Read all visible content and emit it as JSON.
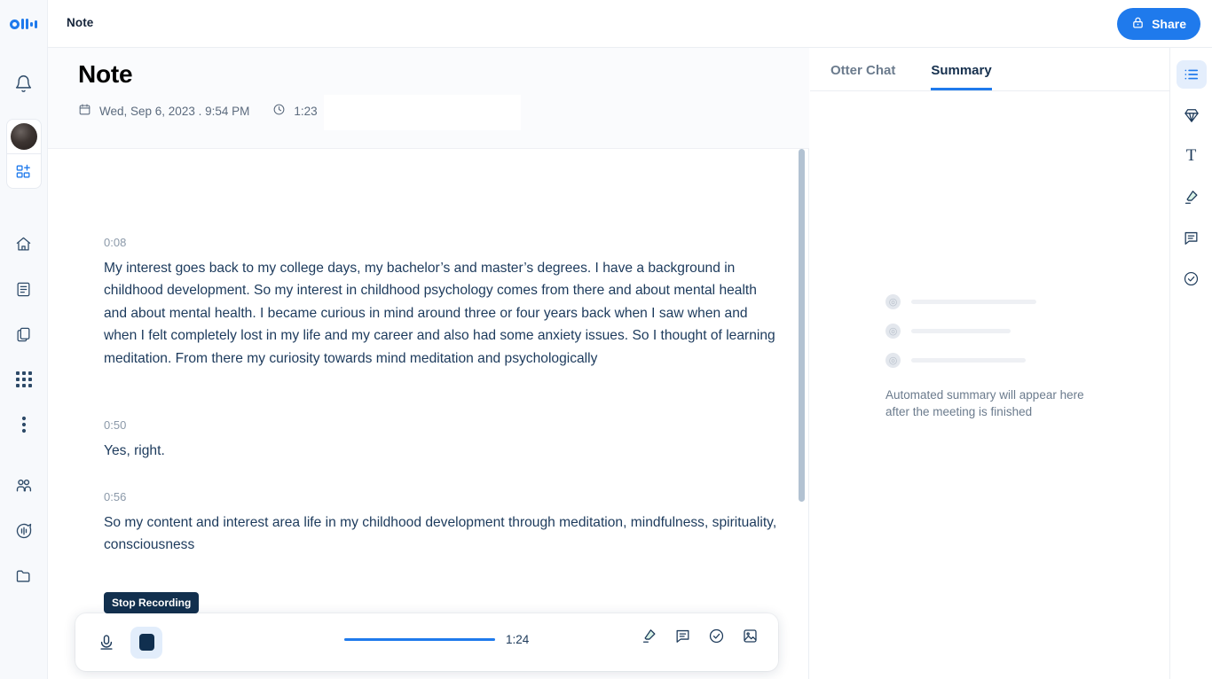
{
  "app": {
    "logo_name": "otter-ai-logo",
    "accent_color": "#1f7aec",
    "text_color": "#1c3a5c"
  },
  "topbar": {
    "title": "Note",
    "share_label": "Share",
    "share_icon": "lock-icon"
  },
  "left_rail": {
    "items": [
      {
        "name": "notifications",
        "icon": "bell-icon"
      },
      {
        "name": "account-avatar",
        "icon": "avatar"
      },
      {
        "name": "new-note",
        "icon": "new-note-icon"
      },
      {
        "name": "home",
        "icon": "home-icon"
      },
      {
        "name": "my-notes",
        "icon": "document-icon"
      },
      {
        "name": "shared-with-me",
        "icon": "copy-icon"
      },
      {
        "name": "all-apps",
        "icon": "grid-icon"
      },
      {
        "name": "more",
        "icon": "more-vertical-icon"
      },
      {
        "name": "people",
        "icon": "people-icon"
      },
      {
        "name": "channels",
        "icon": "speech-wave-icon"
      },
      {
        "name": "folders",
        "icon": "folder-icon"
      }
    ]
  },
  "note": {
    "title": "Note",
    "date": "Wed, Sep 6, 2023 . 9:54 PM",
    "duration": "1:23",
    "calendar_icon": "calendar-icon",
    "clock_icon": "clock-icon"
  },
  "transcript": {
    "segments": [
      {
        "time": "0:08",
        "text": "My interest goes back to my college days, my bachelor’s and master’s degrees. I have a background in childhood development. So my interest in childhood psychology comes from there and about mental health and about mental health. I became curious in mind around three or four years back when I saw when and when I felt completely lost in my life and my career and also had some anxiety issues. So I thought of learning meditation. From there my curiosity towards mind meditation and psychologically"
      },
      {
        "time": "0:50",
        "text": "Yes, right."
      },
      {
        "time": "0:56",
        "text": "So my content and interest area life in my childhood development through meditation, mindfulness, spirituality, consciousness"
      }
    ]
  },
  "recording_bar": {
    "tooltip": "Stop Recording",
    "mic_icon": "microphone-icon",
    "stop_icon": "stop-square-icon",
    "elapsed": "1:24",
    "progress_percent": 100,
    "tools": [
      {
        "name": "highlight",
        "icon": "highlighter-icon"
      },
      {
        "name": "comment",
        "icon": "comment-icon"
      },
      {
        "name": "action-item",
        "icon": "check-circle-icon"
      },
      {
        "name": "add-image",
        "icon": "image-icon"
      }
    ]
  },
  "right_panel": {
    "tabs": [
      {
        "label": "Otter Chat",
        "active": false
      },
      {
        "label": "Summary",
        "active": true
      }
    ],
    "empty_state": {
      "text": "Automated summary will appear here after the meeting is finished",
      "skeleton_rows": 3
    }
  },
  "right_rail": {
    "items": [
      {
        "name": "outline",
        "icon": "list-outline-icon",
        "active": true
      },
      {
        "name": "takeaways",
        "icon": "diamond-icon",
        "active": false
      },
      {
        "name": "text-size",
        "icon": "text-T-icon",
        "active": false,
        "letter": "T"
      },
      {
        "name": "highlights",
        "icon": "highlighter-icon",
        "active": false
      },
      {
        "name": "comments",
        "icon": "comment-icon",
        "active": false
      },
      {
        "name": "action-items",
        "icon": "check-circle-icon",
        "active": false
      }
    ]
  }
}
